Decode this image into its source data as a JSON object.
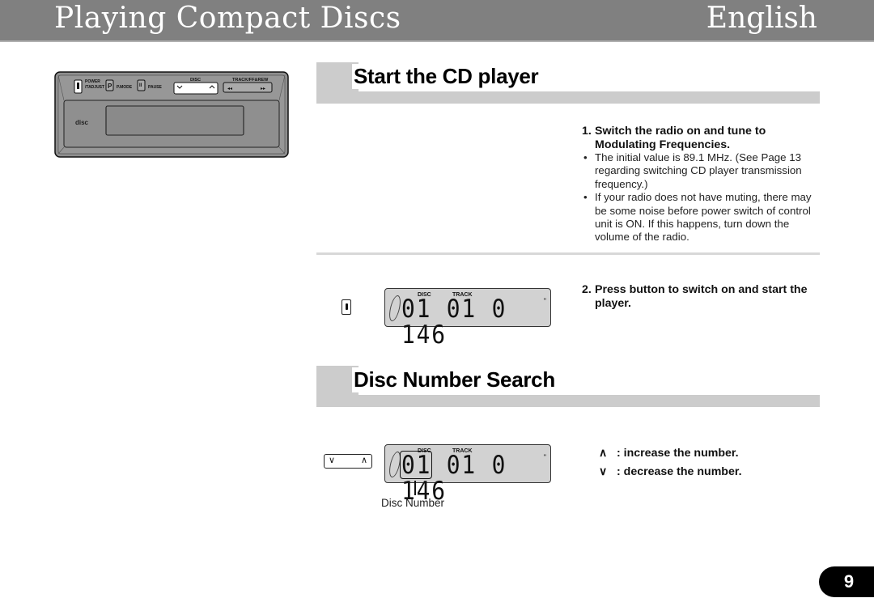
{
  "header": {
    "title": "Playing Compact Discs",
    "language": "English"
  },
  "head_unit": {
    "buttons": [
      {
        "label": "POWER /TADJUST",
        "icon": "power-switch-icon"
      },
      {
        "label": "P.MODE",
        "icon": "p-icon"
      },
      {
        "label": "PAUSE",
        "icon": "pause-icon"
      }
    ],
    "disc_label": "DISC",
    "track_label": "TRACK/FF&REW",
    "disc_down": "∨",
    "disc_up": "∧",
    "rew": "◂◂",
    "ff": "▸▸",
    "logo": "disc"
  },
  "sections": [
    {
      "title": "Start the CD player",
      "steps": [
        {
          "number": "1.",
          "title": "Switch the radio on and tune to Modulating Frequencies.",
          "bullets": [
            "The initial value is 89.1 MHz. (See Page 13 regarding switching CD player transmission frequency.)",
            "If your radio does not have muting, there may be some noise before power switch of control unit is ON. If this happens, turn down the volume of the radio."
          ]
        },
        {
          "number": "2.",
          "title": "Press button to switch on and start the player."
        }
      ]
    },
    {
      "title": "Disc Number Search",
      "legend": [
        {
          "icon": "∧",
          "text": ": increase the number."
        },
        {
          "icon": "∨",
          "text": ": decrease the number."
        }
      ],
      "callout": "Disc Number"
    }
  ],
  "lcd": {
    "disc_label": "DISC",
    "track_label": "TRACK",
    "disc": "01",
    "track": "01",
    "time": "0 146",
    "sec_mark": "\""
  },
  "rocker": {
    "down": "∨",
    "up": "∧"
  },
  "bullet": "•",
  "page_number": "9"
}
